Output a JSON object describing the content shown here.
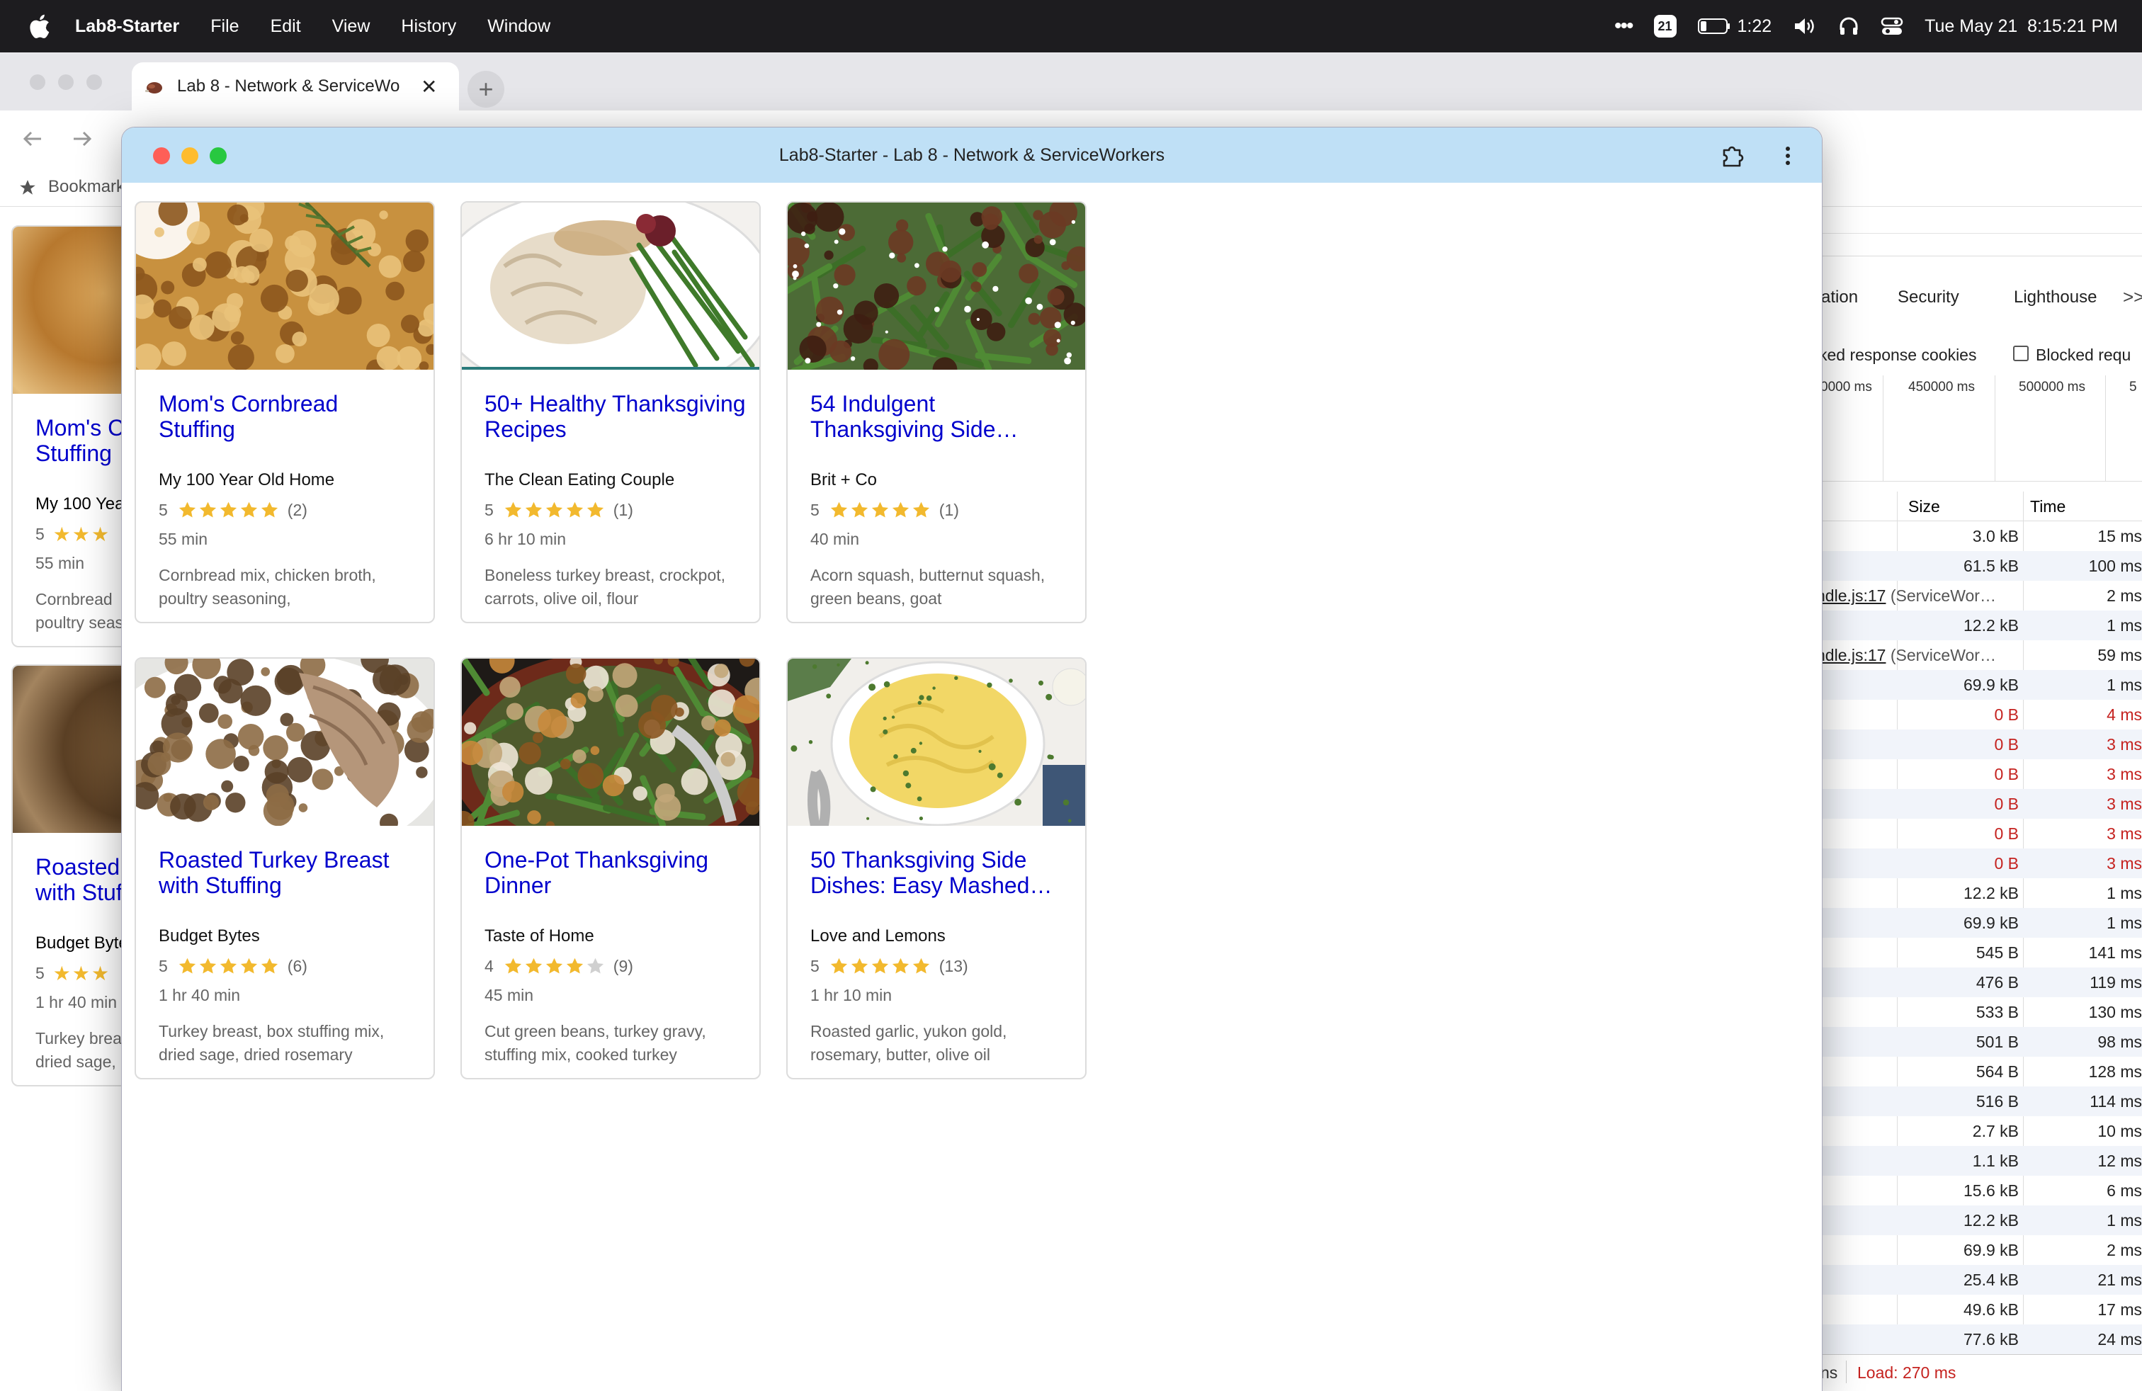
{
  "menubar": {
    "app": "Lab8-Starter",
    "items": [
      "File",
      "Edit",
      "View",
      "History",
      "Window"
    ],
    "battery_time": "1:22",
    "notification_count": "21",
    "datetime": "Tue May 21  8:15:21 PM"
  },
  "back_browser": {
    "tab_title": "Lab 8 - Network & ServiceWo",
    "bookmarks_label": "Bookmarks"
  },
  "popup": {
    "title": "Lab8-Starter - Lab 8 - Network & ServiceWorkers"
  },
  "cards": [
    {
      "title": "Mom's Cornbread Stuffing",
      "org": "My 100 Year Old Home",
      "rating": "5",
      "stars": 5,
      "reviews": "(2)",
      "time": "55 min",
      "ingredients": "Cornbread mix, chicken broth, poultry seasoning,"
    },
    {
      "title": "50+ Healthy Thanksgiving Recipes",
      "org": "The Clean Eating Couple",
      "rating": "5",
      "stars": 5,
      "reviews": "(1)",
      "time": "6 hr 10 min",
      "ingredients": "Boneless turkey breast, crockpot, carrots, olive oil, flour"
    },
    {
      "title": "54 Indulgent Thanksgiving Side…",
      "org": "Brit + Co",
      "rating": "5",
      "stars": 5,
      "reviews": "(1)",
      "time": "40 min",
      "ingredients": "Acorn squash, butternut squash, green beans, goat"
    },
    {
      "title": "Roasted Turkey Breast with Stuffing",
      "org": "Budget Bytes",
      "rating": "5",
      "stars": 5,
      "reviews": "(6)",
      "time": "1 hr 40 min",
      "ingredients": "Turkey breast, box stuffing mix, dried sage, dried rosemary"
    },
    {
      "title": "One-Pot Thanksgiving Dinner",
      "org": "Taste of Home",
      "rating": "4",
      "stars": 4,
      "reviews": "(9)",
      "time": "45 min",
      "ingredients": "Cut green beans, turkey gravy, stuffing mix, cooked turkey"
    },
    {
      "title": "50 Thanksgiving Side Dishes: Easy Mashed…",
      "org": "Love and Lemons",
      "rating": "5",
      "stars": 5,
      "reviews": "(13)",
      "time": "1 hr 10 min",
      "ingredients": "Roasted garlic, yukon gold, rosemary, butter, olive oil"
    }
  ],
  "back_cards": [
    {
      "title": "Mom's C… Stuffing",
      "title1": "Mom's C",
      "title2": "Stuffing",
      "org": "My 100 Yea",
      "rating": "5",
      "time": "55 min",
      "ing1": "Cornbread",
      "ing2": "poultry seas"
    },
    {
      "title1": "Roasted",
      "title2": "with Stuf",
      "org": "Budget Byte",
      "rating": "5",
      "time": "1 hr 40 min",
      "ing1": "Turkey brea",
      "ing2": "dried sage,"
    }
  ],
  "devtools": {
    "tabs": [
      "ation",
      "Security",
      "Lighthouse",
      ">>"
    ],
    "filter_left": "ked response cookies",
    "filter_right": "Blocked requ",
    "timeline_ticks": [
      "0000 ms",
      "450000 ms",
      "500000 ms",
      "5"
    ],
    "col_size": "Size",
    "col_time": "Time",
    "rows": [
      {
        "init": "",
        "size": "3.0 kB",
        "time": "15 ms",
        "red": false
      },
      {
        "init": "",
        "size": "61.5 kB",
        "time": "100 ms",
        "red": false
      },
      {
        "init": "ndle.js:17",
        "init_note": "(ServiceWor…",
        "size": "",
        "time": "2 ms",
        "red": false
      },
      {
        "init": "",
        "size": "12.2 kB",
        "time": "1 ms",
        "red": false
      },
      {
        "init": "ndle.js:17",
        "init_note": "(ServiceWor…",
        "size": "",
        "time": "59 ms",
        "red": false
      },
      {
        "init": "",
        "size": "69.9 kB",
        "time": "1 ms",
        "red": false
      },
      {
        "init": "",
        "size": "0 B",
        "time": "4 ms",
        "red": true
      },
      {
        "init": "",
        "size": "0 B",
        "time": "3 ms",
        "red": true
      },
      {
        "init": "",
        "size": "0 B",
        "time": "3 ms",
        "red": true
      },
      {
        "init": "",
        "size": "0 B",
        "time": "3 ms",
        "red": true
      },
      {
        "init": "",
        "size": "0 B",
        "time": "3 ms",
        "red": true
      },
      {
        "init": "",
        "size": "0 B",
        "time": "3 ms",
        "red": true
      },
      {
        "init": "",
        "size": "12.2 kB",
        "time": "1 ms",
        "red": false
      },
      {
        "init": "",
        "size": "69.9 kB",
        "time": "1 ms",
        "red": false
      },
      {
        "init": "",
        "size": "545 B",
        "time": "141 ms",
        "red": false
      },
      {
        "init": "",
        "size": "476 B",
        "time": "119 ms",
        "red": false
      },
      {
        "init": "",
        "size": "533 B",
        "time": "130 ms",
        "red": false
      },
      {
        "init": "",
        "size": "501 B",
        "time": "98 ms",
        "red": false
      },
      {
        "init": "",
        "size": "564 B",
        "time": "128 ms",
        "red": false
      },
      {
        "init": "",
        "size": "516 B",
        "time": "114 ms",
        "red": false
      },
      {
        "init": "",
        "size": "2.7 kB",
        "time": "10 ms",
        "red": false
      },
      {
        "init": "",
        "size": "1.1 kB",
        "time": "12 ms",
        "red": false
      },
      {
        "init": "",
        "size": "15.6 kB",
        "time": "6 ms",
        "red": false
      },
      {
        "init": "",
        "size": "12.2 kB",
        "time": "1 ms",
        "red": false
      },
      {
        "init": "",
        "size": "69.9 kB",
        "time": "2 ms",
        "red": false
      },
      {
        "init": "",
        "size": "25.4 kB",
        "time": "21 ms",
        "red": false
      },
      {
        "init": "",
        "size": "49.6 kB",
        "time": "17 ms",
        "red": false
      },
      {
        "init": "",
        "size": "77.6 kB",
        "time": "24 ms",
        "red": false
      }
    ],
    "status_left": "ns",
    "status_load": "Load: 270 ms"
  },
  "colors": {
    "link": "#0000cc",
    "star": "#f2b92e",
    "star_empty": "#d0d0d0",
    "popup_titlebar": "#bfe0f6",
    "error_red": "#c5221f"
  },
  "icons": [
    "apple-icon",
    "more-icon",
    "notification-badge-icon",
    "battery-icon",
    "volume-icon",
    "headphones-icon",
    "control-center-icon",
    "close-icon",
    "minimize-icon",
    "zoom-icon",
    "extension-icon",
    "kebab-menu-icon",
    "back-arrow-icon",
    "forward-arrow-icon",
    "bookmark-star-icon",
    "star-icon"
  ]
}
